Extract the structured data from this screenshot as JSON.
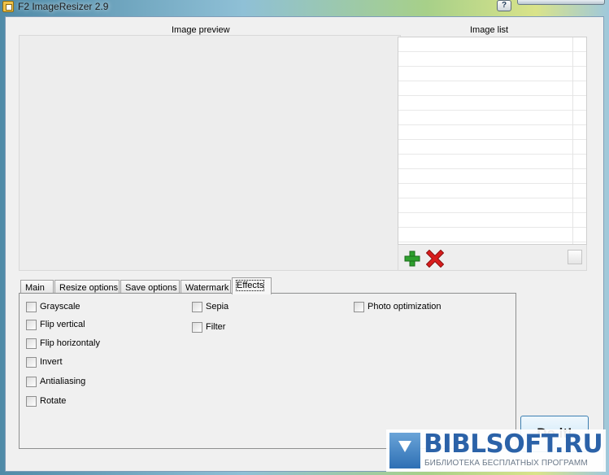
{
  "window": {
    "title": "F2 ImageResizer 2.9",
    "help_label": "?"
  },
  "preview": {
    "label": "Image preview"
  },
  "image_list": {
    "label": "Image list"
  },
  "tabs": [
    {
      "label": "Main"
    },
    {
      "label": "Resize options"
    },
    {
      "label": "Save options"
    },
    {
      "label": "Watermark"
    },
    {
      "label": "Effects"
    }
  ],
  "effects": {
    "col1": [
      {
        "label": "Grayscale",
        "checked": false
      },
      {
        "label": "Flip vertical",
        "checked": false
      },
      {
        "label": "Flip horizontaly",
        "checked": false
      },
      {
        "label": "Invert",
        "checked": false
      },
      {
        "label": "Antialiasing",
        "checked": false
      },
      {
        "label": "Rotate",
        "checked": false
      }
    ],
    "col2": [
      {
        "label": "Sepia",
        "checked": false
      },
      {
        "label": "Filter",
        "checked": false
      }
    ],
    "col3": [
      {
        "label": "Photo optimization",
        "checked": false
      }
    ]
  },
  "do_it_label": "Do it!",
  "watermark": {
    "brand": "BIBLSOFT.RU",
    "tagline": "БИБЛИОТЕКА БЕСПЛАТНЫХ ПРОГРАММ"
  },
  "colors": {
    "add_icon": "#2ea02e",
    "remove_icon": "#d81c1c",
    "brand": "#2b62a8"
  }
}
